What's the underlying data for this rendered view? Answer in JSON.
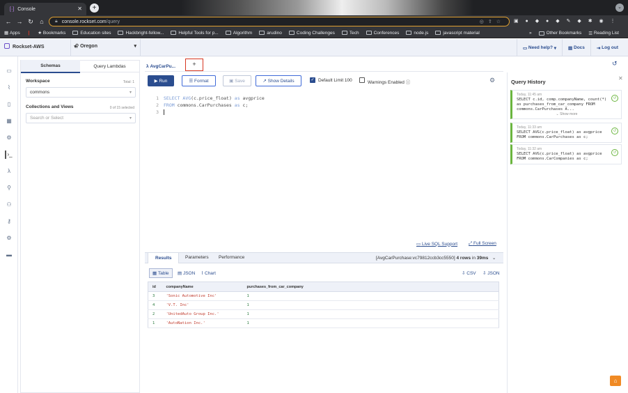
{
  "browser": {
    "tab_title": "Console",
    "url_host": "console.rockset.com",
    "url_path": "/query",
    "bookmarks": [
      "Apps",
      "Bookmarks",
      "Education sites",
      "Hackbright-fellow...",
      "Helpful Tools for p...",
      "Algorithm",
      "arudino",
      "Coding Challenges",
      "Tech",
      "Conferences",
      "node.js",
      "javascript material"
    ],
    "other_bookmarks": "Other Bookmarks",
    "reading_list": "Reading List"
  },
  "header": {
    "org": "Rockset-AWS",
    "region": "Oregon",
    "need_help": "Need help?",
    "docs": "Docs",
    "logout": "Log out"
  },
  "schema_panel": {
    "tabs": [
      "Schemas",
      "Query Lambdas"
    ],
    "workspace_label": "Workspace",
    "workspace_total": "Total: 1",
    "workspace_value": "commons",
    "collections_label": "Collections and Views",
    "collections_count": "0 of 15 selected",
    "search_placeholder": "Search or Select"
  },
  "editor": {
    "tab_label": "AvgCarPu...",
    "plus_label": "+",
    "run_label": "Run",
    "format_label": "Format",
    "save_label": "Save",
    "details_label": "Show Details",
    "limit_label": "Default Limit 100",
    "warnings_label": "Warnings Enabled",
    "lines": [
      "1",
      "2",
      "3"
    ],
    "live_sql": "Live SQL Support",
    "full_screen": "Full Screen"
  },
  "results": {
    "tabs": [
      "Results",
      "Parameters",
      "Performance"
    ],
    "query_id": "[AvgCarPurchase:vc79812ccb3cc5550]",
    "rows_text": "4 rows",
    "in_text": "in",
    "time_text": "39ms",
    "view_table": "Table",
    "view_json": "JSON",
    "view_chart": "Chart",
    "export_csv": "CSV",
    "export_json": "JSON",
    "columns": [
      "id",
      "companyName",
      "purchases_from_car_company"
    ],
    "rows": [
      [
        "3",
        "'Sonic Automotive Inc'",
        "1"
      ],
      [
        "4",
        "'V.T. Inc'",
        "1"
      ],
      [
        "2",
        "'UnitedAuto Group Inc.'",
        "1"
      ],
      [
        "1",
        "'AutoNation Inc.'",
        "1"
      ]
    ]
  },
  "history": {
    "title": "Query History",
    "items": [
      {
        "time": "Today, 11:45 am",
        "query": "SELECT c.id, comp.companyName, count(*)\nas purchases_from_car_company FROM\ncommons.CarPurchases A...",
        "more": "Show more"
      },
      {
        "time": "Today, 11:33 am",
        "query": "SELECT AVG(c.price_float) as avgprice\nFROM commons.CarPurchases as c;"
      },
      {
        "time": "Today, 11:32 am",
        "query": "SELECT AVG(c.price_float) as avgprice\nFROM commons.CarCompanies as c;"
      }
    ]
  },
  "colors": {
    "accent": "#2b4d8f",
    "success": "#6bb53f",
    "highlight": "#d6351f",
    "home": "#f08a24"
  }
}
